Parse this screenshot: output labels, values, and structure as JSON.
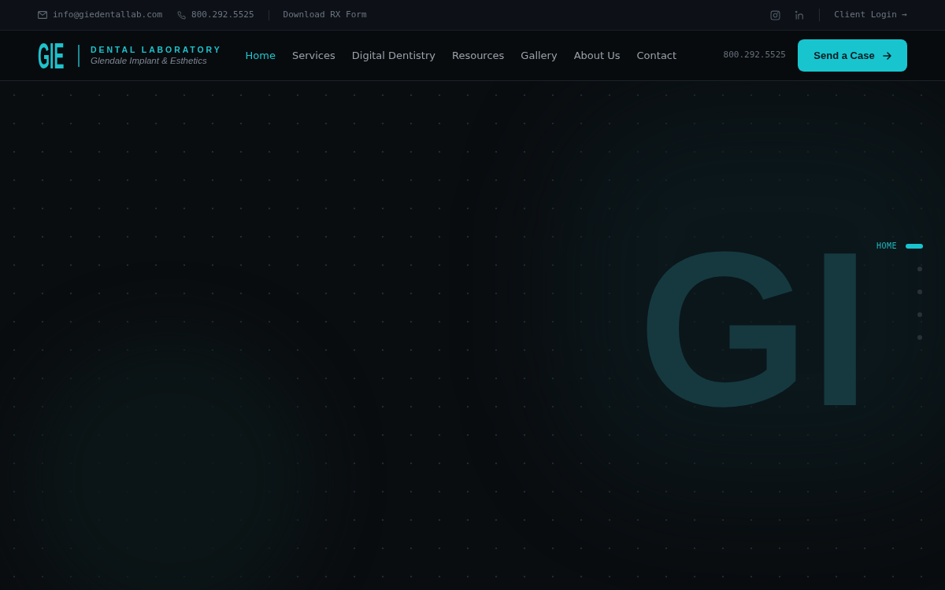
{
  "top_bar": {
    "email": "info@giedentallab.com",
    "phone": "800.292.5525",
    "download_link": "Download RX Form",
    "social": [
      {
        "kind": "instagram"
      },
      {
        "kind": "linkedin"
      }
    ],
    "client_login": "Client Login →"
  },
  "header": {
    "logo": {
      "mark": "GIE",
      "title": "DENTAL LABORATORY",
      "subtitle": "Glendale Implant & Esthetics"
    },
    "nav": [
      {
        "label": "Home",
        "selected": true
      },
      {
        "label": "Services",
        "selected": false
      },
      {
        "label": "Digital Dentistry",
        "selected": false
      },
      {
        "label": "Resources",
        "selected": false
      },
      {
        "label": "Gallery",
        "selected": false
      },
      {
        "label": "About Us",
        "selected": false
      },
      {
        "label": "Contact",
        "selected": false
      }
    ],
    "phone": "800.292.5525",
    "cta": "Send a Case"
  },
  "hero": {
    "backdrop_text": "GI",
    "section_nav": [
      {
        "label": "HOME",
        "selected": true
      },
      {
        "selected": false
      },
      {
        "selected": false
      },
      {
        "selected": false
      },
      {
        "selected": false
      }
    ]
  }
}
